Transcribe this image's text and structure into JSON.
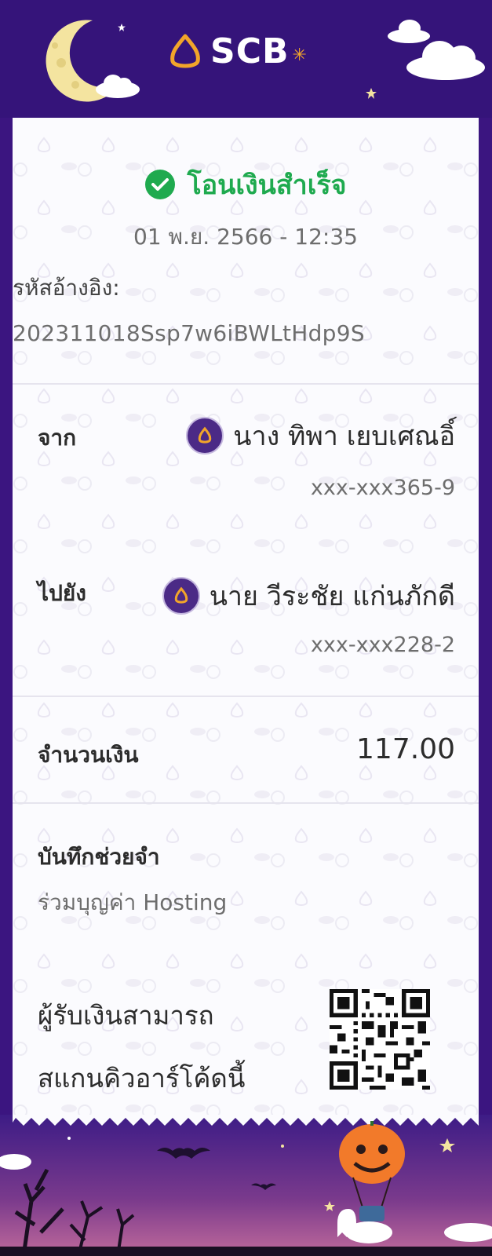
{
  "header": {
    "brand": "SCB"
  },
  "status": {
    "text": "โอนเงินสำเร็จ"
  },
  "datetime": "01 พ.ย. 2566 - 12:35",
  "reference": {
    "label": "รหัสอ้างอิง:",
    "value": "202311018Ssp7w6iBWLtHdp9S"
  },
  "from": {
    "label": "จาก",
    "name": "นาง ทิพา เยบเศณอิ์",
    "account": "xxx-xxx365-9"
  },
  "to": {
    "label": "ไปยัง",
    "name": "นาย วีระชัย แก่นภักดี",
    "account": "xxx-xxx228-2"
  },
  "amount": {
    "label": "จำนวนเงิน",
    "value": "117.00"
  },
  "memo": {
    "label": "บันทึกช่วยจำ",
    "value": "ร่วมบุญค่า Hosting"
  },
  "qr": {
    "line1": "ผู้รับเงินสามารถ",
    "line2": "สแกนคิวอาร์โค้ดนี้"
  },
  "colors": {
    "brand_purple": "#3b1580",
    "success_green": "#1faa4f",
    "logo_gold": "#f2a52a"
  }
}
